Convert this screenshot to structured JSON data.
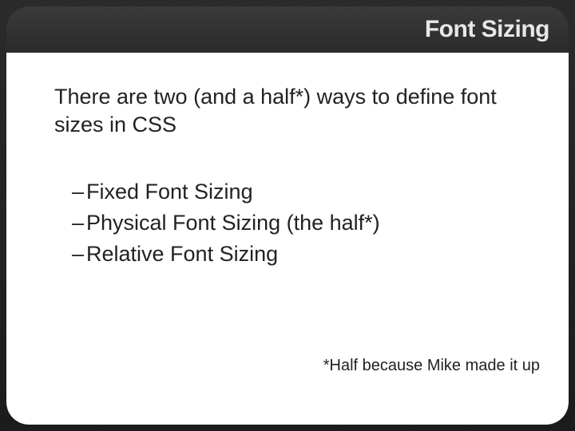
{
  "title": "Font Sizing",
  "intro": "There are two (and a half*) ways to define font sizes in CSS",
  "items": [
    "Fixed Font Sizing",
    "Physical Font Sizing (the half*)",
    "Relative Font Sizing"
  ],
  "footnote": "*Half because Mike made it up"
}
